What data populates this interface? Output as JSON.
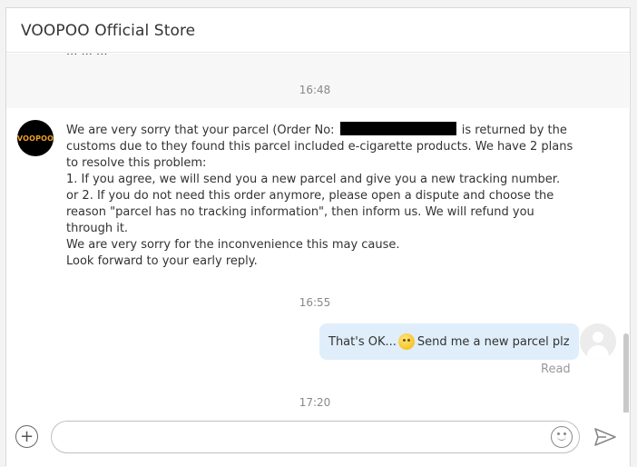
{
  "header": {
    "title": "VOOPOO Official Store"
  },
  "chat": {
    "prev_partial_text": "...  ...  ...",
    "times": [
      "16:48",
      "16:55",
      "17:20"
    ],
    "store_avatar_text": "VOOPOO",
    "store_message": {
      "intro_before": "We are very sorry that your parcel  (Order No: ",
      "intro_after": " is returned by the customs due to they found this parcel included e-cigarette products. We have 2 plans to resolve this problem:",
      "line1": "1. If you agree, we will send you a new parcel and give you a new tracking number.",
      "line2": "or 2. If you do not need this order anymore, please open a dispute and choose the reason \"parcel has no tracking information\", then inform us. We will refund you through it.",
      "line3": "We are very sorry for the inconvenience this may cause.",
      "line4": "Look forward to your early reply."
    },
    "my_message": {
      "before_emoji": "That's OK...",
      "emoji": "flushed-face-emoji",
      "after_emoji": " Send me a new parcel plz"
    },
    "read_status": "Read"
  },
  "composer": {
    "input_value": "",
    "input_placeholder": "",
    "plus_label": "+",
    "icons": [
      "plus-icon",
      "smile-icon",
      "send-icon"
    ]
  },
  "colors": {
    "my_bubble": "#dfeefa",
    "header_text": "#333333",
    "timestamp": "#888888"
  }
}
